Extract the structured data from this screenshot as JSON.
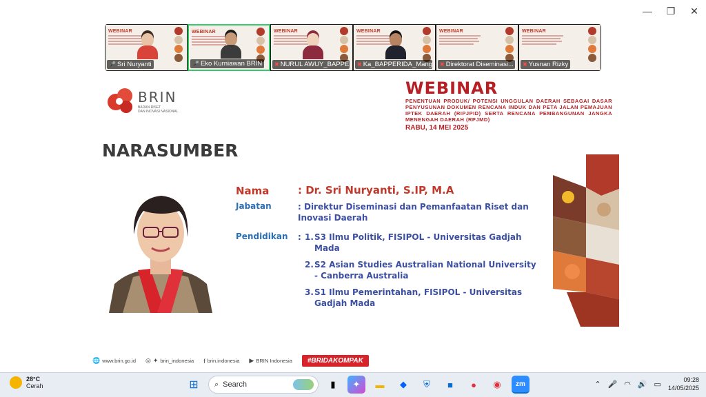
{
  "window": {
    "minimize_glyph": "—",
    "restore_glyph": "❐",
    "close_glyph": "✕"
  },
  "participants": [
    {
      "name": "Sri Nuryanti",
      "muted": false,
      "active": false,
      "skin": "#e8c3a5",
      "shirt": "#d9443a",
      "hair": "#3a2a22"
    },
    {
      "name": "Eko Kurniawan BRIN",
      "muted": false,
      "active": true,
      "skin": "#c99a76",
      "shirt": "#3b3b3b",
      "hair": "#1c1c1c"
    },
    {
      "name": "NURUL AWUY_BAPPE...",
      "muted": true,
      "active": false,
      "skin": "#f1d2bd",
      "shirt": "#8e2a3e",
      "hair": "#8e2a3e"
    },
    {
      "name": "Ka_BAPPERIDA_Mang...",
      "muted": true,
      "active": false,
      "skin": "#b68462",
      "shirt": "#20232d",
      "hair": "#111"
    },
    {
      "name": "Direktorat Diseminasi...",
      "muted": true,
      "active": false,
      "skin": "",
      "shirt": "",
      "hair": ""
    },
    {
      "name": "Yusnan Rizky",
      "muted": true,
      "active": false,
      "skin": "",
      "shirt": "",
      "hair": ""
    }
  ],
  "slide": {
    "logo_name": "BRIN",
    "logo_sub1": "BADAN RISET",
    "logo_sub2": "DAN INOVASI NASIONAL",
    "webinar_title": "WEBINAR",
    "webinar_subtitle": "PENENTUAN PRODUK/ POTENSI UNGGULAN DAERAH SEBAGAI DASAR PENYUSUNAN DOKUMEN RENCANA INDUK DAN PETA JALAN PEMAJUAN IPTEK DAERAH (RIPJPID) SERTA RENCANA PEMBANGUNAN JANGKA MENENGAH DAERAH (RPJMD)",
    "webinar_date": "RABU, 14 MEI 2025",
    "heading": "NARASUMBER",
    "nama_label": "Nama",
    "nama_value": ": Dr. Sri Nuryanti, S.IP, M.A",
    "jabatan_label": "Jabatan",
    "jabatan_value": ": Direktur Diseminasi dan Pemanfaatan Riset dan Inovasi Daerah",
    "pendidikan_label": "Pendidikan",
    "education": [
      {
        "num": "1.",
        "text": "S3 Ilmu Politik, FISIPOL - Universitas Gadjah Mada"
      },
      {
        "num": "2.",
        "text": "S2 Asian Studies Australian National University - Canberra Australia"
      },
      {
        "num": "3.",
        "text": "S1 Ilmu Pemerintahan, FISIPOL - Universitas Gadjah Mada"
      }
    ],
    "footer": {
      "website": "www.brin.go.id",
      "social": "brin_indonesia",
      "facebook": "brin.indonesia",
      "youtube": "BRIN Indonesia",
      "hashtag": "#BRIDAKOMPAK"
    }
  },
  "taskbar": {
    "temperature": "28°C",
    "weather": "Cerah",
    "search_placeholder": "Search",
    "time": "09:28",
    "date": "14/05/2025"
  }
}
